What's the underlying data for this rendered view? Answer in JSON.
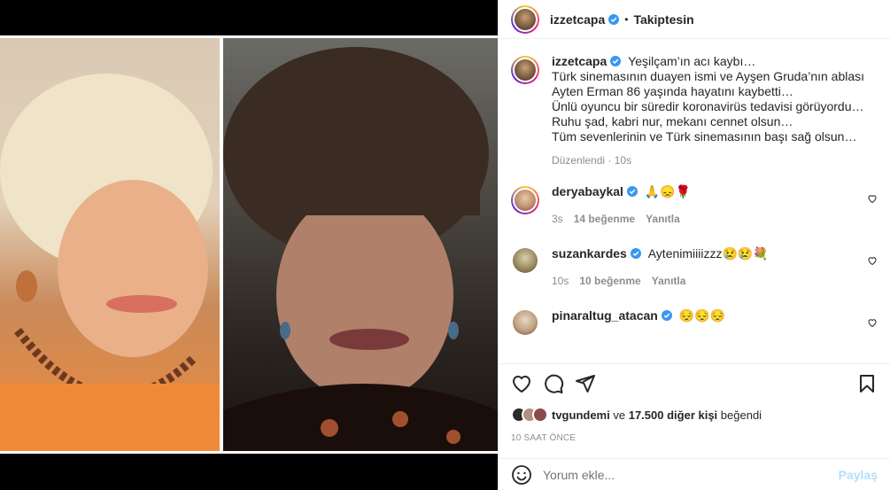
{
  "header": {
    "username": "izzetcapa",
    "follow_status": "Takiptesin"
  },
  "caption": {
    "username": "izzetcapa",
    "lines": [
      "Yeşilçam’ın acı kaybı…",
      "Türk sinemasının duayen ismi ve Ayşen Gruda’nın ablası Ayten Erman 86 yaşında hayatını kaybetti…",
      "Ünlü oyuncu bir süredir koronavirüs tedavisi görüyordu…",
      "Ruhu şad, kabri nur, mekanı cennet olsun…",
      "Tüm sevenlerinin ve Türk sinemasının başı sağ olsun…"
    ],
    "edited": "Düzenlendi",
    "time": "10s"
  },
  "comments": [
    {
      "username": "deryabaykal",
      "text": "🙏😞🌹",
      "time": "3s",
      "likes": "14 beğenme",
      "reply": "Yanıtla"
    },
    {
      "username": "suzankardes",
      "text": "Aytenimiiiizzz😢😢💐",
      "time": "10s",
      "likes": "10 beğenme",
      "reply": "Yanıtla"
    },
    {
      "username": "pinaraltug_atacan",
      "text": "😔😔😔",
      "time": "",
      "likes": "",
      "reply": ""
    }
  ],
  "likes": {
    "user": "tvgundemi",
    "connector": "ve",
    "count": "17.500 diğer kişi",
    "suffix": "beğendi"
  },
  "post_time": "10 SAAT ÖNCE",
  "comment_box": {
    "placeholder": "Yorum ekle...",
    "share_label": "Paylaş"
  },
  "colors": {
    "verified": "#3897f0",
    "share": "#b2dffc",
    "muted": "#8e8e8e"
  }
}
